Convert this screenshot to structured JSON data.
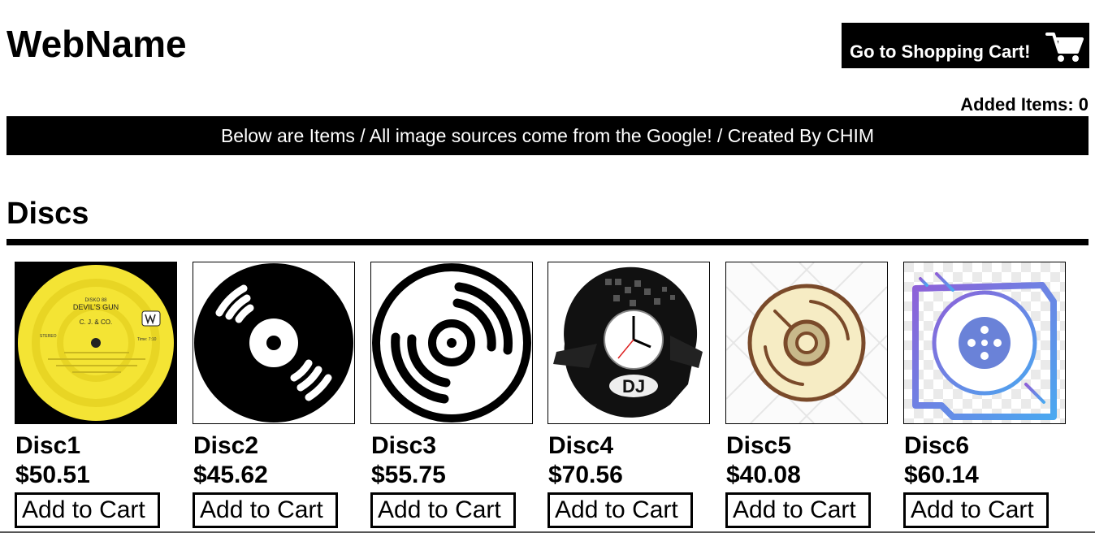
{
  "header": {
    "site_title": "WebName",
    "cart_button_label": "Go to Shopping Cart!",
    "added_items": "Added Items: 0"
  },
  "banner": {
    "text": "Below are Items / All image sources come from the Google! / Created By CHIM"
  },
  "section": {
    "title": "Discs"
  },
  "products": [
    {
      "name": "Disc1",
      "price": "$50.51",
      "button": "Add to Cart",
      "image": "yellow-vinyl-label-image"
    },
    {
      "name": "Disc2",
      "price": "$45.62",
      "button": "Add to Cart",
      "image": "black-vinyl-record-icon"
    },
    {
      "name": "Disc3",
      "price": "$55.75",
      "button": "Add to Cart",
      "image": "outline-disc-icon"
    },
    {
      "name": "Disc4",
      "price": "$70.56",
      "button": "Add to Cart",
      "image": "dj-vinyl-clock-image"
    },
    {
      "name": "Disc5",
      "price": "$40.08",
      "button": "Add to Cart",
      "image": "cream-disc-icon"
    },
    {
      "name": "Disc6",
      "price": "$60.14",
      "button": "Add to Cart",
      "image": "gradient-reel-icon"
    }
  ],
  "label_art": {
    "disc1_lines": [
      "DISKO 88",
      "DEVIL'S GUN",
      "C. J. & CO.",
      "STEREO",
      "Time: 7:10"
    ]
  },
  "colors": {
    "header_bg": "#000000",
    "header_text": "#ffffff",
    "disc1_yellow": "#f4e434",
    "disc5_cream": "#f6ecc4",
    "disc5_brown": "#7a4a2a",
    "disc6_purple": "#8e60d8",
    "disc6_blue": "#4aa8f0",
    "disc6_center": "#6a82d8"
  }
}
